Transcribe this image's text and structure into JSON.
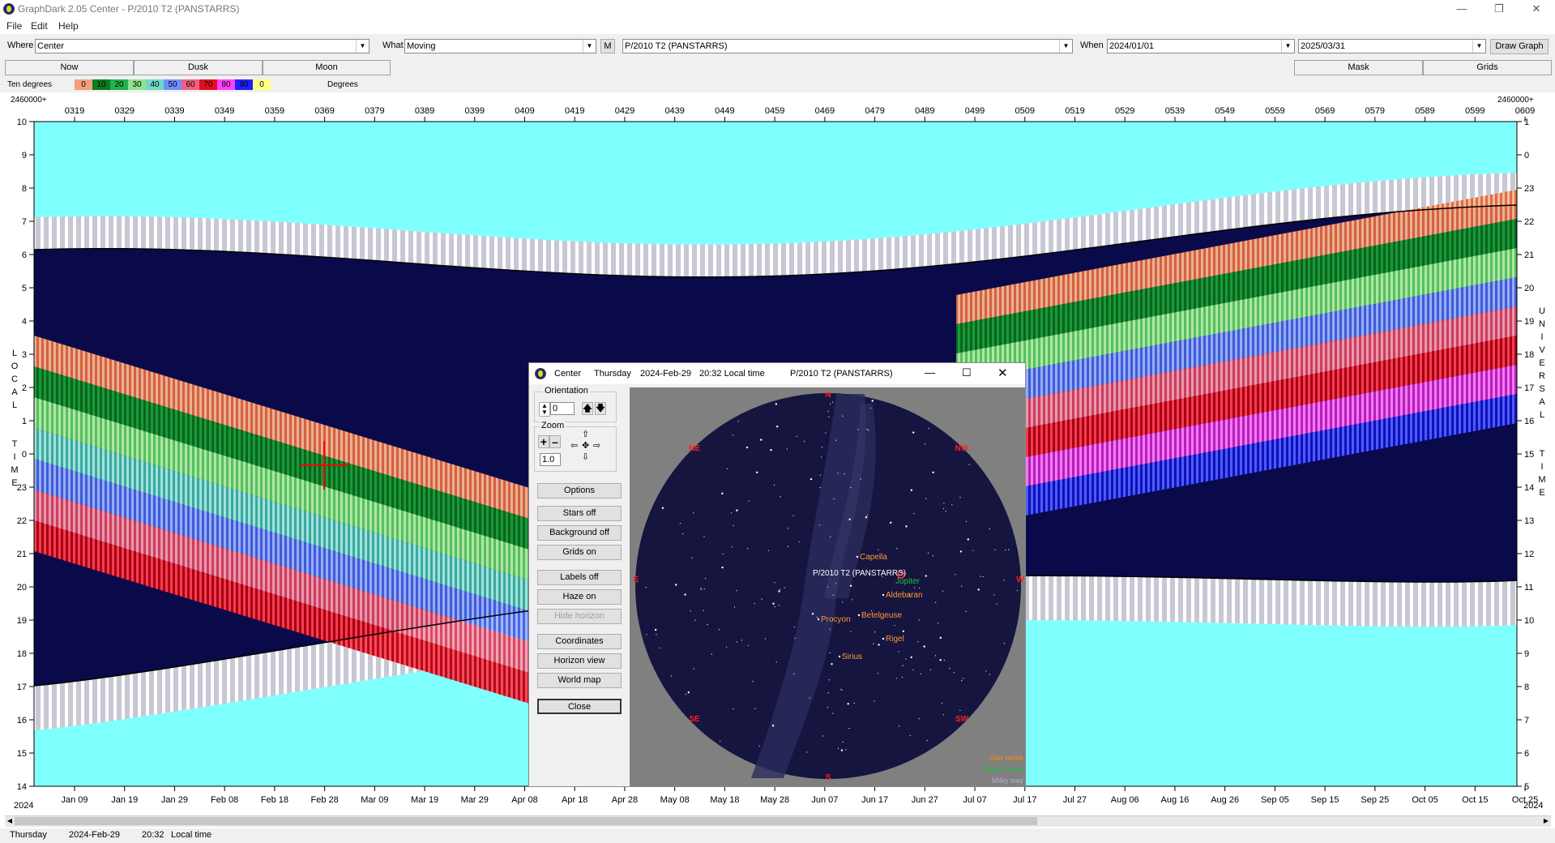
{
  "window": {
    "title": "GraphDark 2.05  Center  -  P/2010 T2 (PANSTARRS)",
    "min_icon": "minimize-icon",
    "max_icon": "maximize-icon",
    "close_icon": "close-icon"
  },
  "menu": [
    "File",
    "Edit",
    "Help"
  ],
  "toolbar": {
    "where_label": "Where",
    "where_value": "Center",
    "what_label": "What",
    "what_value": "Moving",
    "m_button": "M",
    "object_value": "P/2010 T2 (PANSTARRS)",
    "when_label": "When",
    "start_date": "2024/01/01",
    "end_date": "2025/03/31",
    "draw_button": "Draw Graph"
  },
  "tabs_left": [
    "Now",
    "Dusk",
    "Moon"
  ],
  "tabs_right": [
    "Mask",
    "Grids"
  ],
  "legend": {
    "label": "Ten degrees",
    "suffix": "Degrees",
    "swatches": [
      {
        "label": "0",
        "color": "#f2a07a"
      },
      {
        "label": "10",
        "color": "#0a7d1f"
      },
      {
        "label": "20",
        "color": "#22b14c"
      },
      {
        "label": "30",
        "color": "#8fe28f"
      },
      {
        "label": "40",
        "color": "#6fd8c8"
      },
      {
        "label": "50",
        "color": "#6f8fff"
      },
      {
        "label": "60",
        "color": "#f06080"
      },
      {
        "label": "70",
        "color": "#e01020"
      },
      {
        "label": "80",
        "color": "#ff40ff"
      },
      {
        "label": "90",
        "color": "#2020ff"
      },
      {
        "label": "0",
        "color": "#ffff80"
      }
    ]
  },
  "chart": {
    "jd_label_left": "2460000+",
    "jd_label_right": "2460000+",
    "jd_ticks": [
      "0319",
      "0329",
      "0339",
      "0349",
      "0359",
      "0369",
      "0379",
      "0389",
      "0399",
      "0409",
      "0419",
      "0429",
      "0439",
      "0449",
      "0459",
      "0469",
      "0479",
      "0489",
      "0499",
      "0509",
      "0519",
      "0529",
      "0539",
      "0549",
      "0559",
      "0569",
      "0579",
      "0589",
      "0599",
      "0609"
    ],
    "date_ticks": [
      "Jan 09",
      "Jan 19",
      "Jan 29",
      "Feb 08",
      "Feb 18",
      "Feb 28",
      "Mar 09",
      "Mar 19",
      "Mar 29",
      "Apr 08",
      "Apr 18",
      "Apr 28",
      "May 08",
      "May 18",
      "May 28",
      "Jun 07",
      "Jun 17",
      "Jun 27",
      "Jul 07",
      "Jul 17",
      "Jul 27",
      "Aug 06",
      "Aug 16",
      "Aug 26",
      "Sep 05",
      "Sep 15",
      "Sep 25",
      "Oct 05",
      "Oct 15",
      "Oct 25"
    ],
    "left_axis": [
      "10",
      "9",
      "8",
      "7",
      "6",
      "5",
      "4",
      "3",
      "2",
      "1",
      "0",
      "23",
      "22",
      "21",
      "20",
      "19",
      "18",
      "17",
      "16",
      "15",
      "14"
    ],
    "right_axis": [
      "1",
      "0",
      "23",
      "22",
      "21",
      "20",
      "19",
      "18",
      "17",
      "16",
      "15",
      "14",
      "13",
      "12",
      "11",
      "10",
      "9",
      "8",
      "7",
      "6",
      "5"
    ],
    "left_title": "LOCAL TIME",
    "right_title": "UNIVERSAL TIME",
    "year_left": "2024",
    "year_right": "2024",
    "bg_color": "#80ffff",
    "night_color": "#0a0a4a"
  },
  "status": {
    "day": "Thursday",
    "date": "2024-Feb-29",
    "time": "20:32",
    "zone": "Local time"
  },
  "dialog": {
    "title_name": "Center",
    "title_day": "Thursday",
    "title_date": "2024-Feb-29",
    "title_time": "20:32 Local time",
    "title_object": "P/2010 T2 (PANSTARRS)",
    "orientation_label": "Orientation",
    "orientation_value": "0",
    "zoom_label": "Zoom",
    "zoom_value": "1.0",
    "buttons": [
      "Options",
      "Stars off",
      "Background off",
      "Grids on",
      "Labels off",
      "Haze on",
      "Hide horizon",
      "Coordinates",
      "Horizon view",
      "World map",
      "Close"
    ],
    "compass": [
      "N",
      "NE",
      "NW",
      "E",
      "W",
      "SE",
      "SW",
      "S"
    ],
    "object_label": "P/2010 T2 (PANSTARRS)",
    "stars": [
      "Capella",
      "Aldebaran",
      "Betelgeuse",
      "Procyon",
      "Rigel",
      "Sirius"
    ],
    "planet": "Jupiter",
    "key": [
      "Star name",
      "Planet name",
      "Milky way"
    ]
  }
}
